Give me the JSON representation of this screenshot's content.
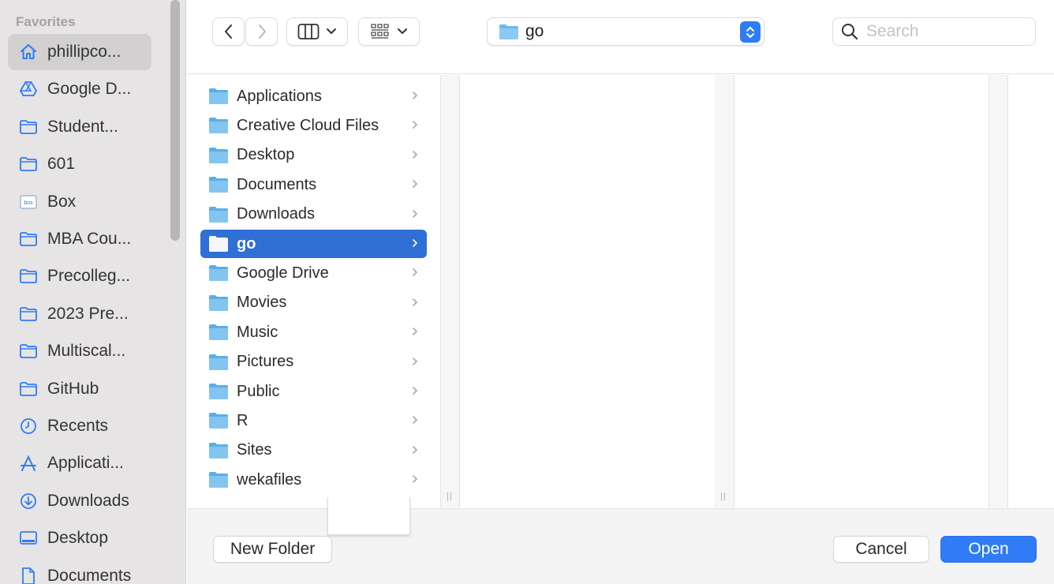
{
  "sidebar": {
    "heading": "Favorites",
    "items": [
      {
        "label": "phillipco...",
        "icon": "home-icon"
      },
      {
        "label": "Google D...",
        "icon": "google-drive-icon"
      },
      {
        "label": "Student...",
        "icon": "folder-icon"
      },
      {
        "label": "601",
        "icon": "folder-icon"
      },
      {
        "label": "Box",
        "icon": "box-icon"
      },
      {
        "label": "MBA Cou...",
        "icon": "folder-icon"
      },
      {
        "label": "Precolleg...",
        "icon": "folder-icon"
      },
      {
        "label": "2023 Pre...",
        "icon": "folder-icon"
      },
      {
        "label": "Multiscal...",
        "icon": "folder-icon"
      },
      {
        "label": "GitHub",
        "icon": "folder-icon"
      },
      {
        "label": "Recents",
        "icon": "clock-icon"
      },
      {
        "label": "Applicati...",
        "icon": "applications-icon"
      },
      {
        "label": "Downloads",
        "icon": "download-icon"
      },
      {
        "label": "Desktop",
        "icon": "desktop-icon"
      },
      {
        "label": "Documents",
        "icon": "document-icon"
      }
    ],
    "box_icon_text": "box"
  },
  "toolbar": {
    "path": "go",
    "search_placeholder": "Search"
  },
  "columns": {
    "items": [
      {
        "label": "Applications"
      },
      {
        "label": "Creative Cloud Files"
      },
      {
        "label": "Desktop"
      },
      {
        "label": "Documents"
      },
      {
        "label": "Downloads"
      },
      {
        "label": "go",
        "selected": true
      },
      {
        "label": "Google Drive"
      },
      {
        "label": "Movies"
      },
      {
        "label": "Music"
      },
      {
        "label": "Pictures"
      },
      {
        "label": "Public"
      },
      {
        "label": "R"
      },
      {
        "label": "Sites"
      },
      {
        "label": "wekafiles"
      }
    ]
  },
  "buttons": {
    "new_folder": "New Folder",
    "cancel": "Cancel",
    "open": "Open"
  },
  "colors": {
    "accent": "#2f7cf6",
    "selection": "#2f6fd6",
    "folder": "#6cb8ee"
  }
}
